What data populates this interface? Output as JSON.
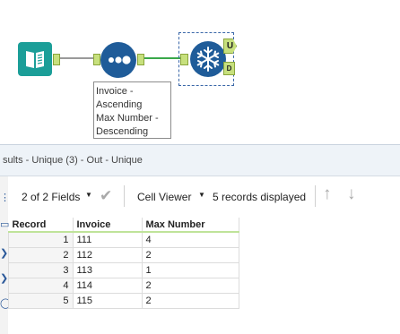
{
  "workflow": {
    "annotation_lines": [
      "Invoice -",
      "Ascending",
      "Max Number -",
      "Descending"
    ],
    "anchor_unique": "U",
    "anchor_duplicate": "D"
  },
  "results": {
    "title": "sults - Unique (3) - Out - Unique"
  },
  "toolbar": {
    "fields_label": "2 of 2 Fields",
    "viewer_label": "Cell Viewer",
    "records_label": "5 records displayed"
  },
  "table": {
    "headers": [
      "Record",
      "Invoice",
      "Max Number"
    ],
    "rows": [
      [
        "1",
        "111",
        "4"
      ],
      [
        "2",
        "112",
        "2"
      ],
      [
        "3",
        "113",
        "1"
      ],
      [
        "4",
        "114",
        "2"
      ],
      [
        "5",
        "115",
        "2"
      ]
    ]
  },
  "colors": {
    "input_tool": "#1b9e98",
    "sort_tool": "#1f5c99",
    "unique_tool": "#1f5c99",
    "anchor": "#c7e07d",
    "connection_active": "#3aa84a"
  }
}
